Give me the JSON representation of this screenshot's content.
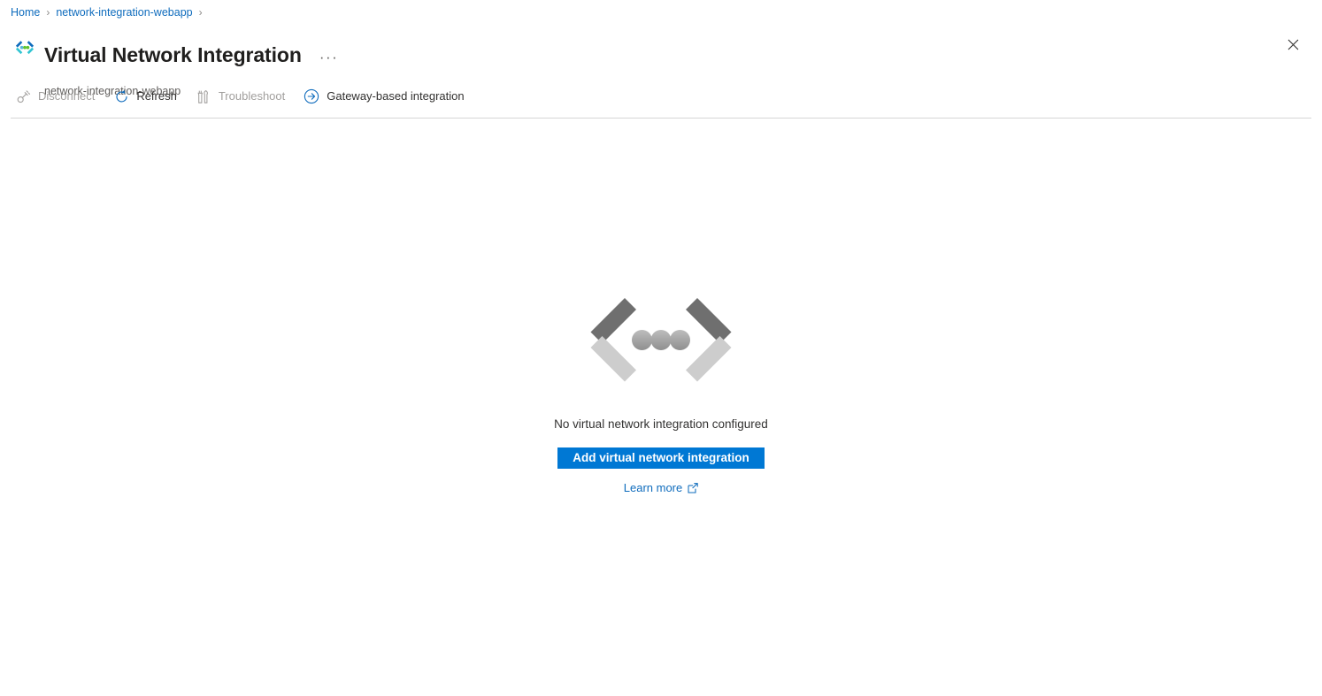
{
  "breadcrumb": {
    "items": [
      {
        "label": "Home"
      },
      {
        "label": "network-integration-webapp"
      }
    ],
    "separator": "›"
  },
  "header": {
    "title": "Virtual Network Integration",
    "subtitle": "network-integration-webapp",
    "icon": "code-brackets-dots-icon",
    "more_label": "···",
    "close_label": "✕"
  },
  "command_bar": {
    "items": [
      {
        "label": "Disconnect",
        "icon": "disconnect-plug-icon",
        "disabled": true
      },
      {
        "label": "Refresh",
        "icon": "refresh-icon",
        "disabled": false
      },
      {
        "label": "Troubleshoot",
        "icon": "troubleshoot-tools-icon",
        "disabled": true
      },
      {
        "label": "Gateway-based integration",
        "icon": "arrow-right-circle-icon",
        "disabled": false
      }
    ]
  },
  "empty_state": {
    "illustration": "code-brackets-dots-illustration",
    "message": "No virtual network integration configured",
    "primary_button": "Add virtual network integration",
    "learn_more": "Learn more",
    "learn_more_icon": "external-link-icon"
  },
  "colors": {
    "accent": "#0078d4",
    "link": "#0f6cbd",
    "text": "#323130",
    "text_secondary": "#605e5c",
    "disabled": "#a19f9d",
    "divider": "#d6d6d6",
    "illustration_dark": "#767676",
    "illustration_light": "#cfcfcf"
  }
}
